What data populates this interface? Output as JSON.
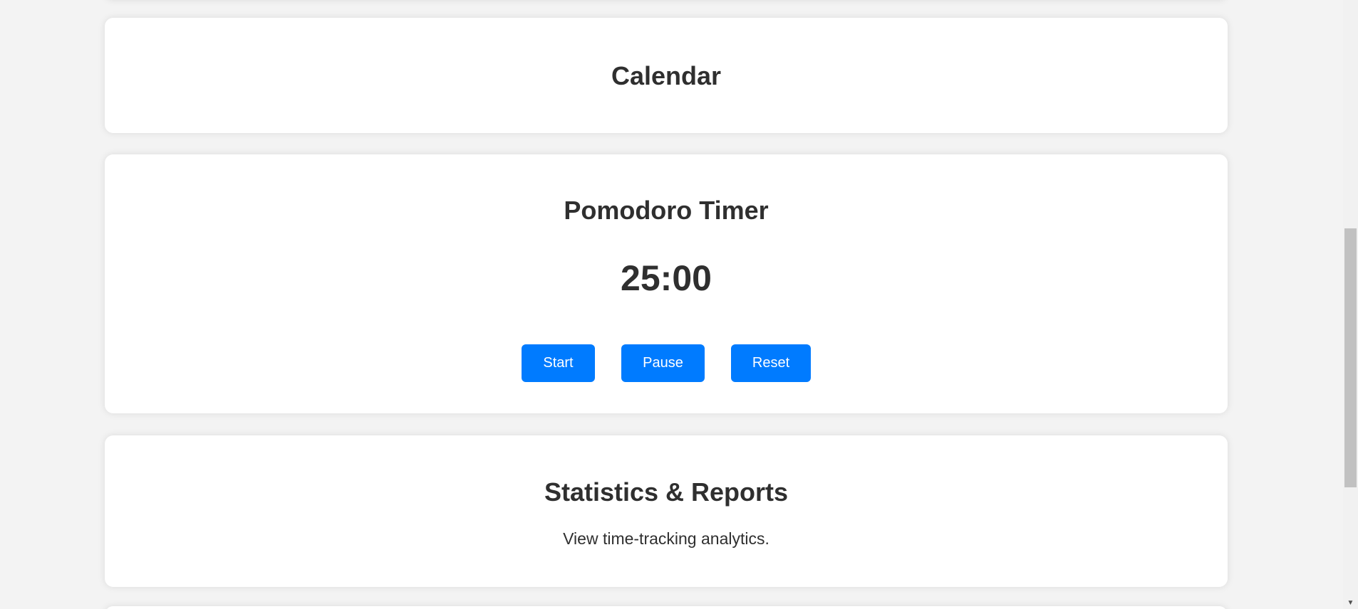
{
  "calendar": {
    "title": "Calendar"
  },
  "timer": {
    "title": "Pomodoro Timer",
    "display": "25:00",
    "buttons": {
      "start": "Start",
      "pause": "Pause",
      "reset": "Reset"
    },
    "button_color": "#007bff"
  },
  "stats": {
    "title": "Statistics & Reports",
    "description": "View time-tracking analytics."
  },
  "scrollbar": {
    "down_arrow": "▼"
  }
}
